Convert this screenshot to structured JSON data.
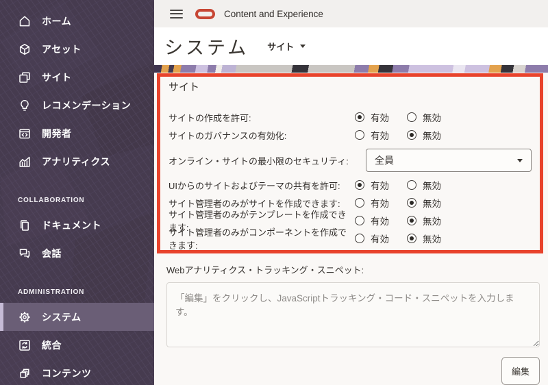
{
  "topbar": {
    "app_title": "Content and Experience"
  },
  "page": {
    "title": "システム",
    "scope_selector": "サイト"
  },
  "sidebar": {
    "sections": [
      {
        "header": "",
        "items": [
          {
            "label": "ホーム",
            "icon": "home-icon"
          },
          {
            "label": "アセット",
            "icon": "assets-cube-icon"
          },
          {
            "label": "サイト",
            "icon": "sites-icon"
          },
          {
            "label": "レコメンデーション",
            "icon": "lightbulb-icon"
          },
          {
            "label": "開発者",
            "icon": "developer-code-icon"
          },
          {
            "label": "アナリティクス",
            "icon": "analytics-chart-icon"
          }
        ]
      },
      {
        "header": "COLLABORATION",
        "items": [
          {
            "label": "ドキュメント",
            "icon": "documents-icon"
          },
          {
            "label": "会話",
            "icon": "conversation-icon"
          }
        ]
      },
      {
        "header": "ADMINISTRATION",
        "items": [
          {
            "label": "システム",
            "icon": "gear-icon",
            "active": true
          },
          {
            "label": "統合",
            "icon": "integration-icon"
          },
          {
            "label": "コンテンツ",
            "icon": "content-stack-icon"
          }
        ]
      }
    ]
  },
  "settings": {
    "group_title": "サイト",
    "option_labels": {
      "enabled": "有効",
      "disabled": "無効"
    },
    "rows": [
      {
        "label": "サイトの作成を許可:",
        "type": "radio",
        "selected": "有効"
      },
      {
        "label": "サイトのガバナンスの有効化:",
        "type": "radio",
        "selected": "無効"
      },
      {
        "label": "オンライン・サイトの最小限のセキュリティ:",
        "type": "select",
        "value": "全員"
      },
      {
        "label": "UIからのサイトおよびテーマの共有を許可:",
        "type": "radio",
        "selected": "有効"
      },
      {
        "label": "サイト管理者のみがサイトを作成できます:",
        "type": "radio",
        "selected": "無効"
      },
      {
        "label": "サイト管理者のみがテンプレートを作成できます:",
        "type": "radio",
        "selected": "無効"
      },
      {
        "label": "サイト管理者のみがコンポーネントを作成できます:",
        "type": "radio",
        "selected": "無効"
      }
    ]
  },
  "snippet": {
    "label": "Webアナリティクス・トラッキング・スニペット:",
    "placeholder": "「編集」をクリックし、JavaScriptトラッキング・コード・スニペットを入力します。",
    "edit_button": "編集"
  },
  "colors": {
    "sidebar_bg": "#463b4f",
    "sidebar_active_bg": "#6a5e76",
    "sidebar_active_accent": "#c6bbd6",
    "topbar_bg": "#f2f0ee",
    "oracle_logo_red": "#c74634",
    "highlight_outline_red": "#e8432c",
    "panel_bg": "#faf8f6"
  }
}
